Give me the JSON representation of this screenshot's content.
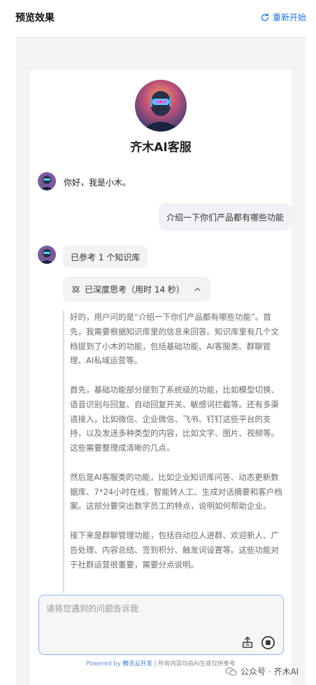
{
  "header": {
    "title": "预览效果",
    "restart_label": "重新开始"
  },
  "bot": {
    "name": "齐木AI客服"
  },
  "chat": {
    "greeting": "你好，我是小木。",
    "user_message": "介绍一下你们产品都有哪些功能",
    "knowledge_ref": "已参考 1 个知识库",
    "thinking_label": "已深度思考（用时 14 秒）",
    "thought_paragraphs": [
      "好的，用户问的是“介绍一下你们产品都有哪些功能”。首先，我需要根据知识库里的信息来回答。知识库里有几个文档提到了小木的功能，包括基础功能、AI客服类、群聊管理、AI私域运营等。",
      "首先，基础功能部分提到了系统级的功能，比如模型切换、语音识别与回复、自动回复开关、敏感词拦截等。还有多渠道接入，比如微信、企业微信、飞书、钉钉这些平台的支持，以及发送多种类型的内容，比如文字、图片、视频等。这些需要整理成清晰的几点。",
      "然后是AI客服类的功能，比如企业知识库问答、动态更新数据库、7*24小时在线、智能转人工、生成对话摘要和客户档案。这部分要突出数字员工的特点，说明如何帮助企业。",
      "接下来是群聊管理功能，包括自动拉人进群、欢迎新人、广告处理、内容总结、签到积分、触发词设置等。这些功能对于社群运营很重要，需要分点说明。"
    ]
  },
  "input": {
    "placeholder": "请将您遇到的问题告诉我"
  },
  "footer": {
    "powered_by": "Powered by",
    "brand": "腾讯云开发",
    "separator": " | ",
    "disclaimer": "所有内容均由AI生成仅供参考"
  },
  "watermark": {
    "text": "公众号 · 齐木AI"
  },
  "colors": {
    "accent": "#1f6feb",
    "panel_bg": "#f4f4f5",
    "bubble_bg": "#f1f2f6",
    "input_border": "#8ab4f8"
  },
  "icons": {
    "restart": "refresh-icon",
    "think": "atom-icon",
    "collapse": "chevron-up-icon",
    "upload": "upload-icon",
    "stop": "stop-icon",
    "wechat": "wechat-icon"
  }
}
